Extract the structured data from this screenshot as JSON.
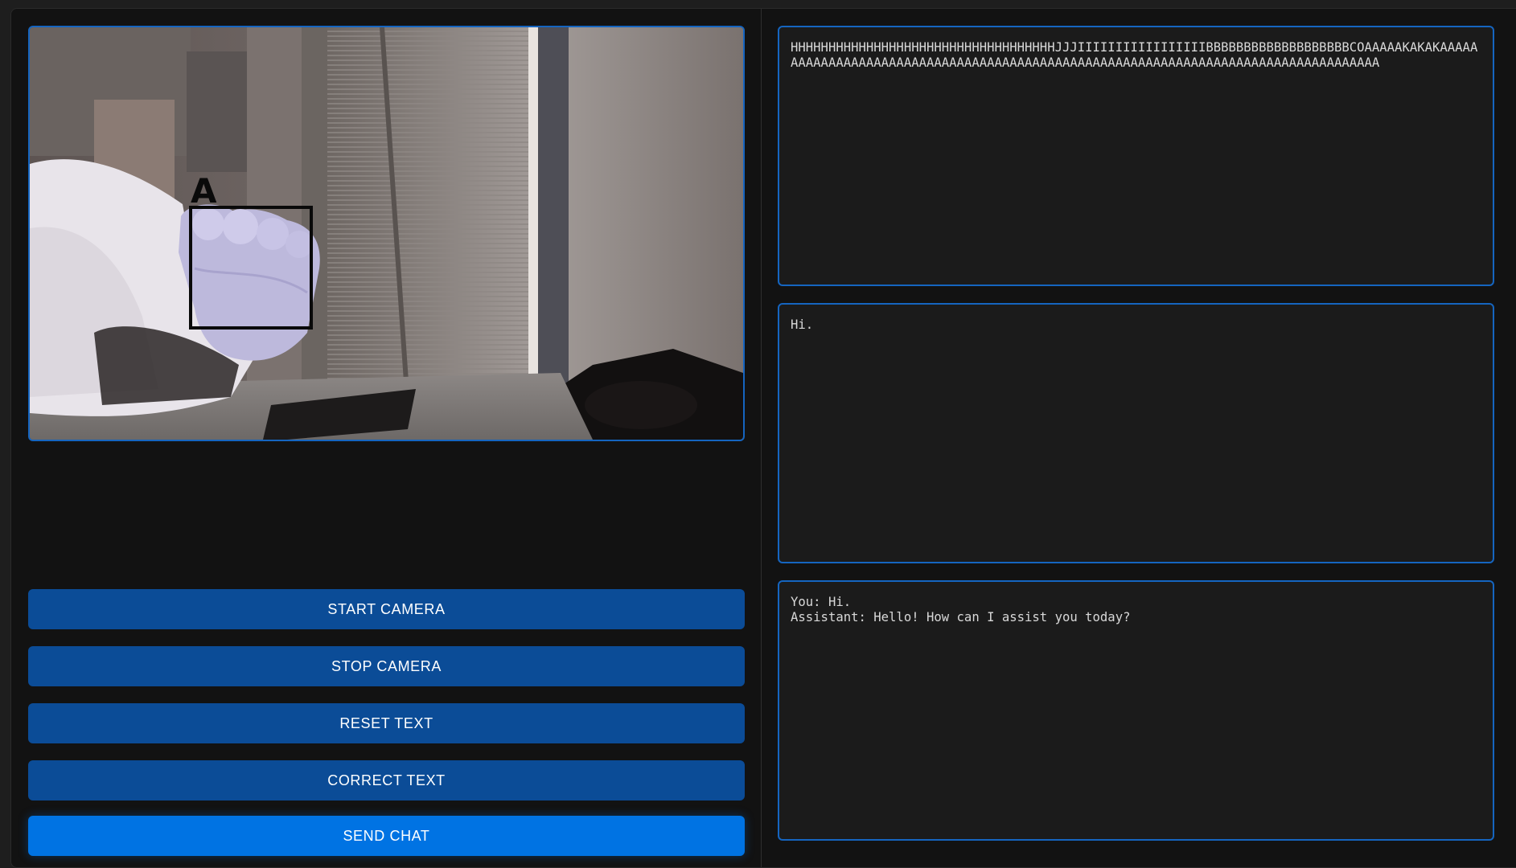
{
  "camera": {
    "overlay_letter": "A"
  },
  "buttons": {
    "start_camera": "START CAMERA",
    "stop_camera": "STOP CAMERA",
    "reset_text": "RESET TEXT",
    "correct_text": "CORRECT TEXT",
    "send_chat": "SEND CHAT"
  },
  "panels": {
    "recognized_text": "HHHHHHHHHHHHHHHHHHHHHHHHHHHHHHHHHHHJJJIIIIIIIIIIIIIIIIIBBBBBBBBBBBBBBBBBBBCOAAAAAKAKAKAAAAAAAAAAAAAAAAAAAAAAAAAAAAAAAAAAAAAAAAAAAAAAAAAAAAAAAAAAAAAAAAAAAAAAAAAAAAAAAAAAA",
    "corrected_text": "Hi.",
    "chat_log": "You: Hi.\nAssistant: Hello! How can I assist you today?"
  },
  "colors": {
    "accent_border": "#1565c0",
    "button_bg": "#0b4c97",
    "button_primary_bg": "#0073e3",
    "panel_bg": "#1b1b1b",
    "page_bg": "#121212"
  }
}
